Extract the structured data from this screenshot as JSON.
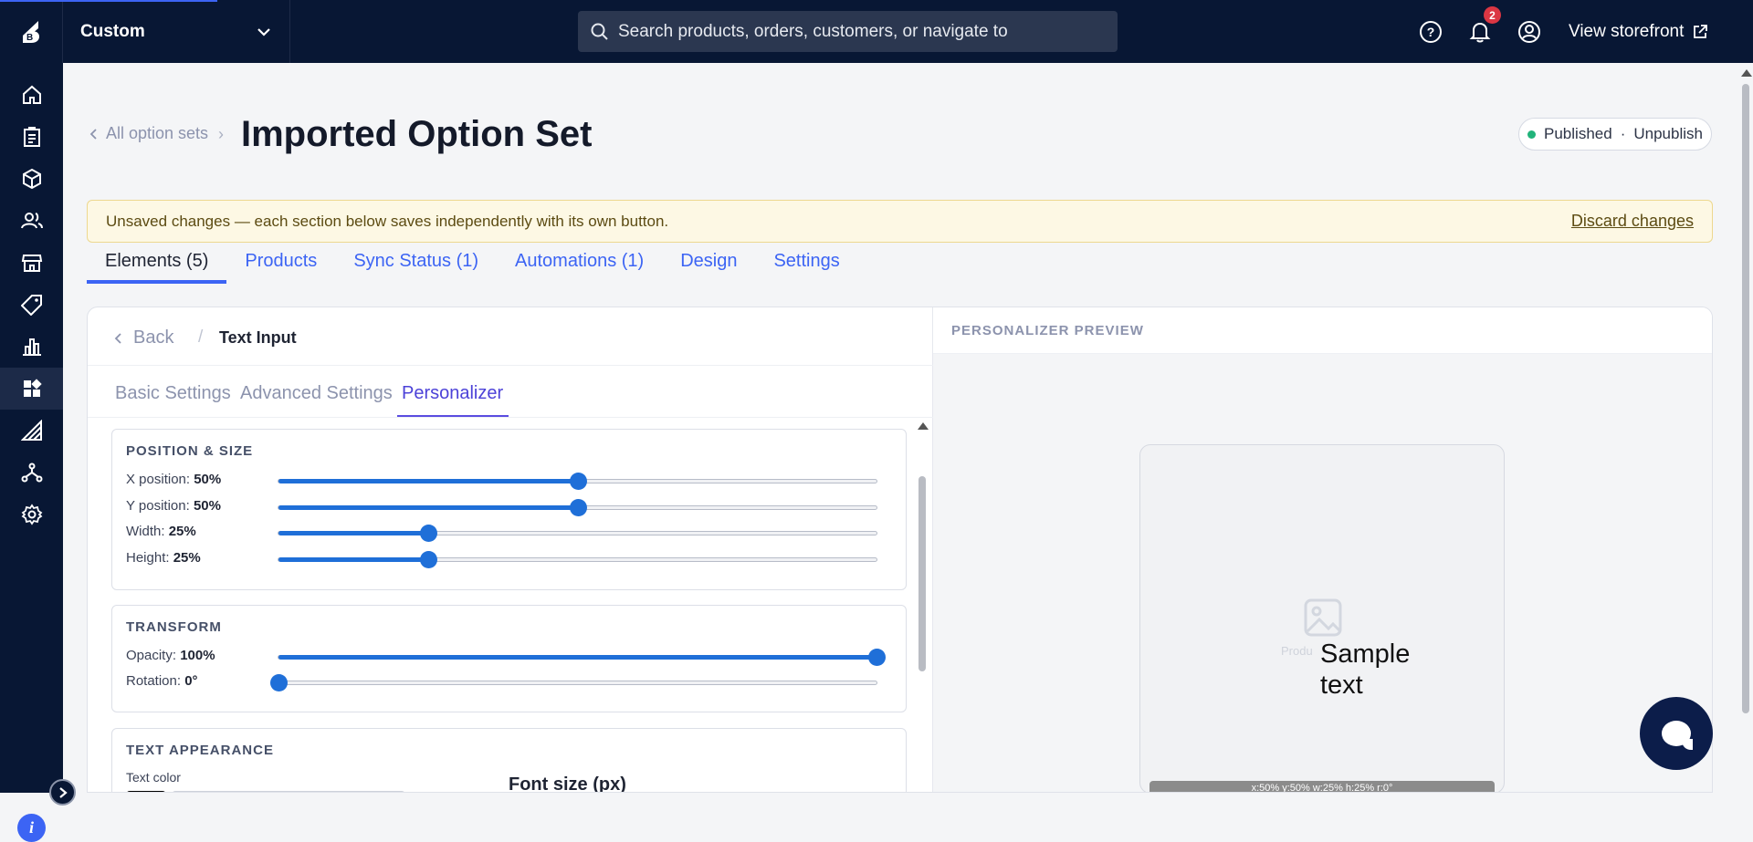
{
  "topbar": {
    "store_name": "Custom",
    "search_placeholder": "Search products, orders, customers, or navigate to",
    "notification_count": "2",
    "view_storefront": "View storefront"
  },
  "sidebar": {
    "items": [
      "home-icon",
      "orders-icon",
      "products-icon",
      "customers-icon",
      "storefront-icon",
      "marketing-icon",
      "analytics-icon",
      "apps-icon",
      "channel-manager-icon",
      "settings-icon"
    ],
    "active_index": 7
  },
  "breadcrumb": {
    "back_label": "All option sets"
  },
  "page": {
    "title": "Imported Option Set",
    "status": "Published",
    "status_separator": "·",
    "unpublish": "Unpublish",
    "status_color": "#21b37a"
  },
  "banner": {
    "message": "Unsaved changes — each section below saves independently with its own button.",
    "discard": "Discard changes"
  },
  "tabs": [
    {
      "label": "Elements (5)",
      "active": true
    },
    {
      "label": "Products"
    },
    {
      "label": "Sync Status (1)"
    },
    {
      "label": "Automations (1)"
    },
    {
      "label": "Design"
    },
    {
      "label": "Settings"
    }
  ],
  "editor": {
    "back_label": "Back",
    "separator": "/",
    "element_title": "Text Input",
    "subtabs": [
      "Basic Settings",
      "Advanced Settings",
      "Personalizer"
    ],
    "active_subtab": "Personalizer",
    "sections": {
      "position_size": {
        "title": "POSITION & SIZE",
        "rows": [
          {
            "label": "X position:",
            "value": "50%",
            "level": 50
          },
          {
            "label": "Y position:",
            "value": "50%",
            "level": 50
          },
          {
            "label": "Width:",
            "value": "25%",
            "level": 25
          },
          {
            "label": "Height:",
            "value": "25%",
            "level": 25
          }
        ]
      },
      "transform": {
        "title": "TRANSFORM",
        "rows": [
          {
            "label": "Opacity:",
            "value": "100%",
            "level": 100
          },
          {
            "label": "Rotation:",
            "value": "0°",
            "level": 0
          }
        ]
      },
      "text_appearance": {
        "title": "TEXT APPEARANCE",
        "color_label": "Text color",
        "color_value": "#000000",
        "font_size_label": "Font size (px)"
      }
    }
  },
  "preview": {
    "header": "PERSONALIZER PREVIEW",
    "placeholder_text": "Produ",
    "sample_text": "Sample text",
    "overlay": "x:50% y:50% w:25% h:25% r:0°"
  },
  "colors": {
    "accent": "#3c64f4",
    "slider": "#1f6fd8",
    "nav": "#081734"
  }
}
